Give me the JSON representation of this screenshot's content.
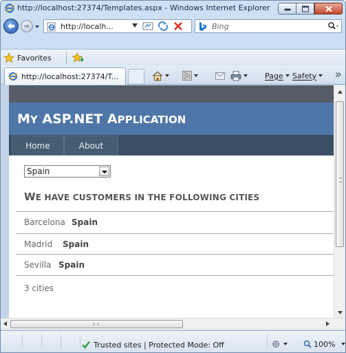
{
  "window": {
    "title": "http://localhost:27374/Templates.aspx - Windows Internet Explorer"
  },
  "address_bar": {
    "url_display": "http://localh...",
    "search_placeholder": "Bing"
  },
  "favorites_bar": {
    "favorites_label": "Favorites"
  },
  "tab": {
    "label": "http://localhost:27374/T..."
  },
  "command_bar": {
    "page_label": "Page",
    "safety_label": "Safety"
  },
  "page": {
    "site_title_first": "M",
    "site_title_rest_caps": "Y",
    "site_title_middle": " ASP.NET A",
    "site_title_end": "PPLICATION",
    "menu": [
      {
        "label": "Home"
      },
      {
        "label": "About"
      }
    ],
    "country_select": {
      "selected": "Spain"
    },
    "heading": {
      "first": "W",
      "rest": "E HAVE CUSTOMERS IN THE FOLLOWING CITIES"
    },
    "cities": [
      {
        "city": "Barcelona",
        "country": "Spain"
      },
      {
        "city": "Madrid",
        "country": "Spain"
      },
      {
        "city": "Sevilla",
        "country": "Spain"
      }
    ],
    "count_text": "3 cities"
  },
  "status_bar": {
    "zone_text": "Trusted sites | Protected Mode: Off",
    "zoom": "100%"
  },
  "colors": {
    "header_blue": "#4f76a8",
    "menu_dark": "#3a4f63",
    "page_top_bar": "#555c66"
  }
}
